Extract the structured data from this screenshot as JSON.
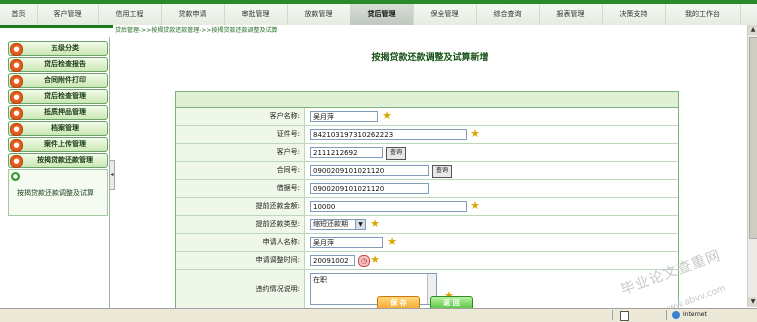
{
  "nav": {
    "items": [
      "首页",
      "客户管理",
      "信用工程",
      "贷款申请",
      "审批管理",
      "放款管理",
      "贷后管理",
      "保全管理",
      "综合查询",
      "报表管理",
      "决策支持",
      "我的工作台"
    ],
    "active_index": 6
  },
  "breadcrumb": "贷后管理->>按揭贷款还款管理->>按揭贷款还款调整及试算",
  "sidebar": {
    "items": [
      "五级分类",
      "贷后检查报告",
      "合同附件打印",
      "贷后检查管理",
      "抵质押品管理",
      "档案管理",
      "案件上传管理",
      "按揭贷款还款管理"
    ],
    "submenu_label": "按揭贷款还款调整及试算"
  },
  "page_title": "按揭贷款还款调整及试算新增",
  "form": {
    "customer_name_label": "客户名称:",
    "customer_name_value": "吴月萍",
    "id_number_label": "证件号:",
    "id_number_value": "842103197310262223",
    "customer_no_label": "客户号:",
    "customer_no_value": "2111212692",
    "query_label": "查询",
    "contract_no_label": "合同号:",
    "contract_no_value": "0900209101021120",
    "loan_no_label": "借据号:",
    "loan_no_value": "0900209101021120",
    "prepay_amount_label": "提前还款金额:",
    "prepay_amount_value": "10000",
    "prepay_type_label": "提前还款类型:",
    "prepay_type_value": "缩短还款期",
    "applicant_label": "申请人名称:",
    "applicant_value": "吴月萍",
    "apply_time_label": "申请调整时间:",
    "apply_time_value": "20091002",
    "reason_label": "违约情况说明:",
    "reason_value": "在职"
  },
  "buttons": {
    "save": "保 存",
    "back": "返 回"
  },
  "statusbar": {
    "zone": "Internet"
  },
  "watermark": "毕业论文查重网",
  "watermark_url": "www.abvv.com",
  "colors": {
    "brand_green": "#2a8a2a",
    "star": "#d8a800",
    "save": "#f3a52a",
    "back": "#4ec23a"
  }
}
